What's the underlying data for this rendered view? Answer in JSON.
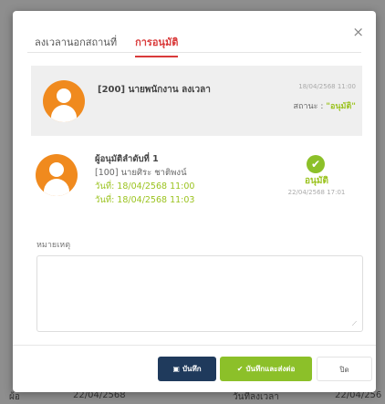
{
  "background": {
    "bottom_left": "ผ้อ",
    "bottom_mid": "22/04/2568",
    "bottom_right_label": "วันที่ลงเวลา",
    "bottom_right_val": "22/04/256"
  },
  "tabs": [
    {
      "label": "ลงเวลานอกสถานที่",
      "active": false
    },
    {
      "label": "การอนุมัติ",
      "active": true
    }
  ],
  "close_glyph": "×",
  "request": {
    "name": "[200] นายพนักงาน ลงเวลา",
    "date": "18/04/2568 11:00",
    "status_label": "สถานะ :",
    "status_value": "\"อนุมัติ\""
  },
  "approver": {
    "title": "ผู้อนุมัติลำดับที่ 1",
    "name": "[100] นายศิระ ชาติพงน์",
    "date_line1": "วันที่: 18/04/2568 11:00",
    "date_line2": "วันที่: 18/04/2568 11:03",
    "status": "อนุมัติ",
    "status_time": "22/04/2568 17:01"
  },
  "note": {
    "label": "หมายเหตุ",
    "value": ""
  },
  "buttons": {
    "save": "บันทึก",
    "save_forward": "บันทึกและส่งต่อ",
    "close": "ปิด"
  },
  "colors": {
    "accent_red": "#d93a3a",
    "approve_green": "#8cc029",
    "save_navy": "#1f3a5c",
    "avatar_orange": "#f08a1e"
  },
  "icons": {
    "save": "floppy-disk-icon",
    "save_forward": "check-icon",
    "approved": "check-circle-icon",
    "close": "close-icon"
  }
}
